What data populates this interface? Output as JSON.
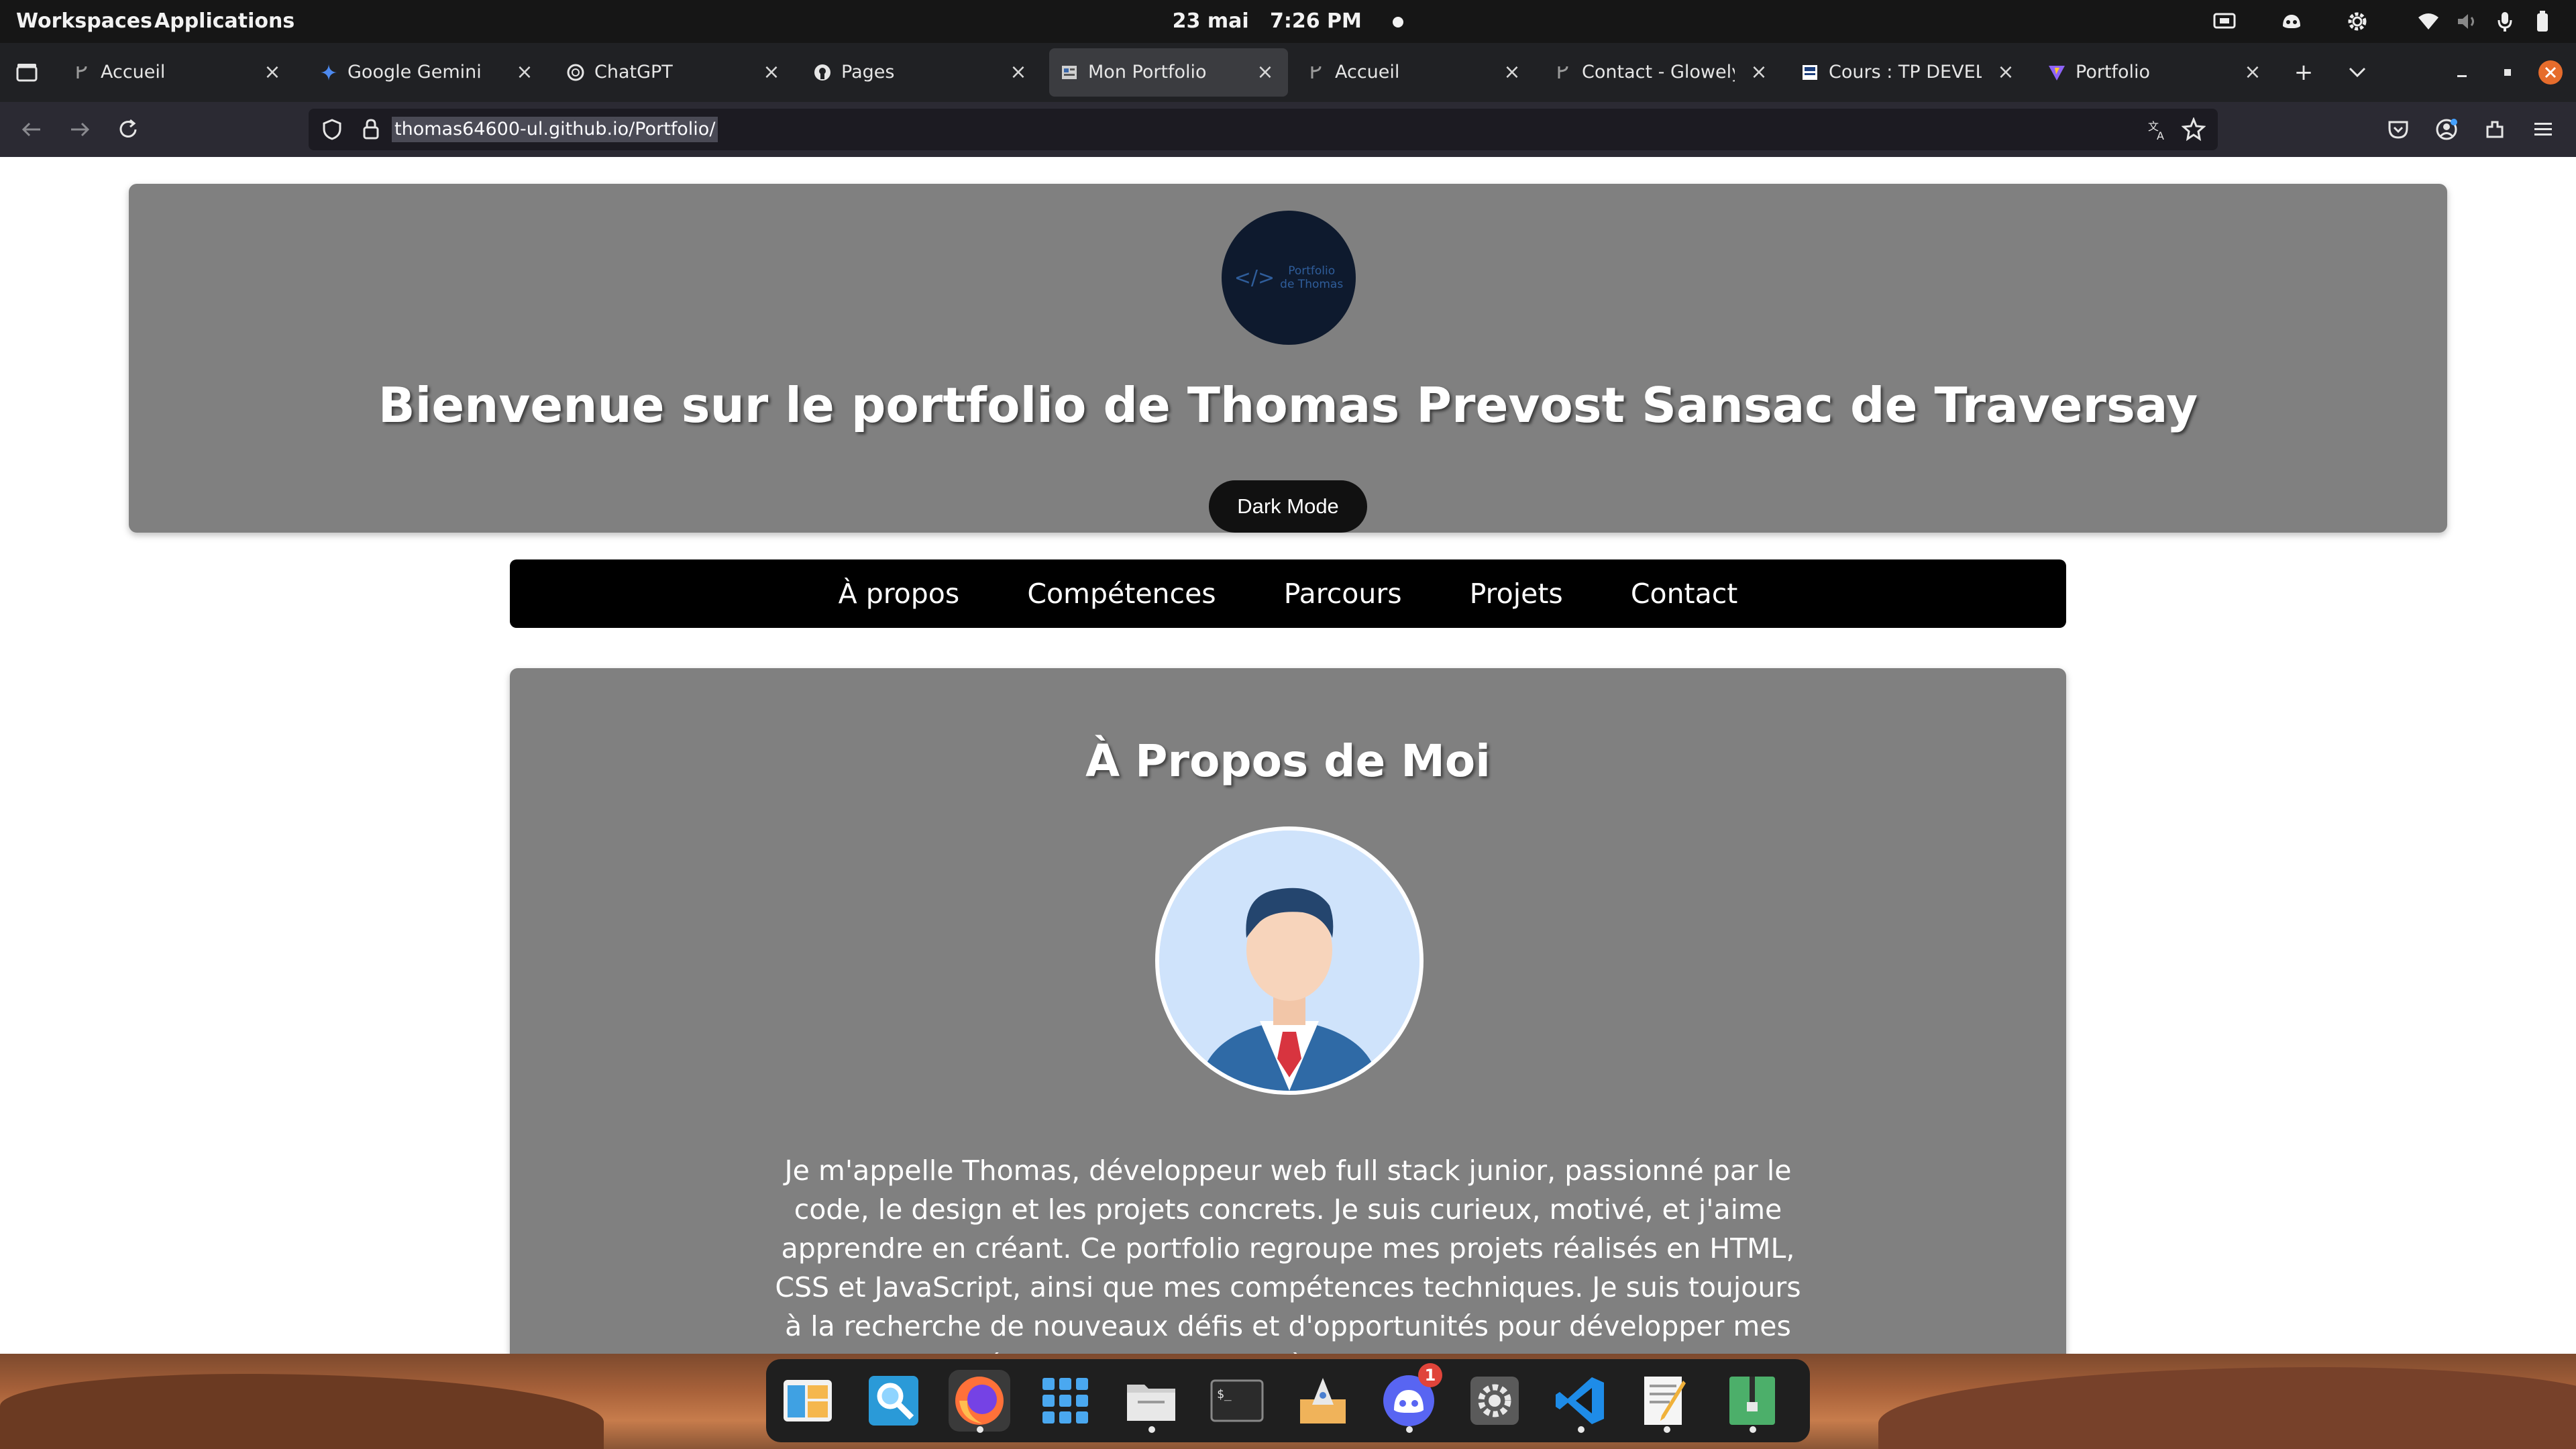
{
  "system_bar": {
    "workspaces": "Workspaces",
    "applications": "Applications",
    "date": "23 mai",
    "time": "7:26 PM",
    "tray_icons": [
      "screen-share-icon",
      "discord-icon",
      "settings-icon",
      "wifi-icon",
      "volume-icon",
      "microphone-icon",
      "battery-icon"
    ]
  },
  "tabs": [
    {
      "label": "Accueil",
      "icon": "branch-icon",
      "active": false
    },
    {
      "label": "Google Gemini",
      "icon": "gemini-icon",
      "active": false
    },
    {
      "label": "ChatGPT",
      "icon": "chatgpt-icon",
      "active": false
    },
    {
      "label": "Pages",
      "icon": "github-icon",
      "active": false
    },
    {
      "label": "Mon Portfolio",
      "icon": "portfolio-icon",
      "active": true
    },
    {
      "label": "Accueil",
      "icon": "branch-icon",
      "active": false
    },
    {
      "label": "Contact - Glowely",
      "icon": "branch-icon",
      "active": false
    },
    {
      "label": "Cours : TP DEVELOPPE",
      "icon": "course-icon",
      "active": false
    },
    {
      "label": "Portfolio",
      "icon": "vite-icon",
      "active": false
    }
  ],
  "address_bar": {
    "url": "thomas64600-ul.github.io/Portfolio/"
  },
  "page": {
    "logo_line1": "Portfolio",
    "logo_line2": "de Thomas",
    "logo_code": "</>",
    "title": "Bienvenue sur le portfolio de Thomas Prevost Sansac de Traversay",
    "dark_mode_label": "Dark Mode",
    "nav": [
      "À propos",
      "Compétences",
      "Parcours",
      "Projets",
      "Contact"
    ],
    "about_title": "À Propos de Moi",
    "about_text": "Je m'appelle Thomas, développeur web full stack junior, passionné par le code, le design et les projets concrets. Je suis curieux, motivé, et j'aime apprendre en créant. Ce portfolio regroupe mes projets réalisés en HTML, CSS et JavaScript, ainsi que mes compétences techniques. Je suis toujours à la recherche de nouveaux défis et d'opportunités pour développer mes compétences et contribuer à des projets passionnants."
  },
  "dock": {
    "items": [
      "files-manager-icon",
      "search-app-icon",
      "firefox-icon",
      "app-grid-icon",
      "folder-icon",
      "terminal-icon",
      "launcher-icon",
      "discord-icon",
      "settings-icon",
      "vscode-icon",
      "text-editor-icon",
      "archive-icon"
    ],
    "discord_badge": "1"
  },
  "colors": {
    "hero_bg": "#808080",
    "nav_bg": "#000000",
    "browser_bg": "#202124",
    "url_bg": "#1c1b22"
  }
}
